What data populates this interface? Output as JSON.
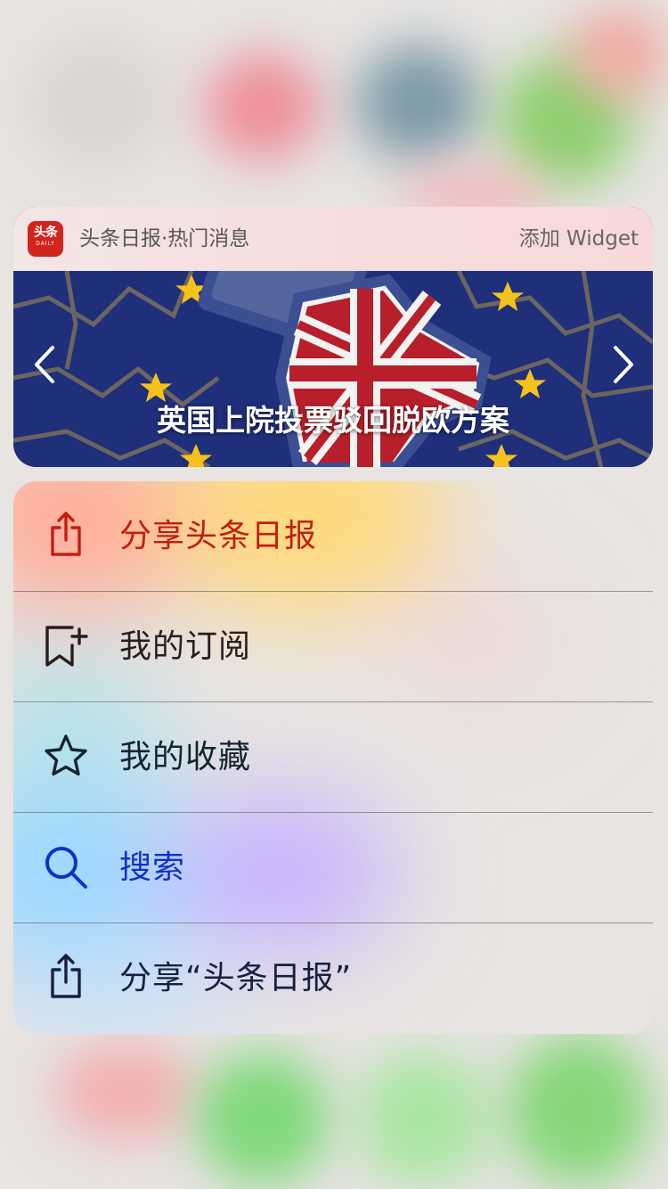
{
  "widget": {
    "app_icon_text": "头条",
    "app_icon_subtext": "DAILY",
    "title": "头条日报·热门消息",
    "action": "添加 Widget",
    "headline": "英国上院投票驳回脱欧方案"
  },
  "menu": {
    "items": [
      {
        "label": "分享头条日报",
        "icon": "share-icon",
        "color": "#c31d12"
      },
      {
        "label": "我的订阅",
        "icon": "bookmark-add-icon",
        "color": "#2a1d1d"
      },
      {
        "label": "我的收藏",
        "icon": "star-icon",
        "color": "#13252e"
      },
      {
        "label": "搜索",
        "icon": "search-icon",
        "color": "#1230c7"
      },
      {
        "label": "分享“头条日报”",
        "icon": "share-icon",
        "color": "#17213e"
      }
    ]
  },
  "colors": {
    "brand_red": "#d2231c",
    "eu_blue": "#1f2f7a",
    "eu_star": "#f4c21a"
  }
}
